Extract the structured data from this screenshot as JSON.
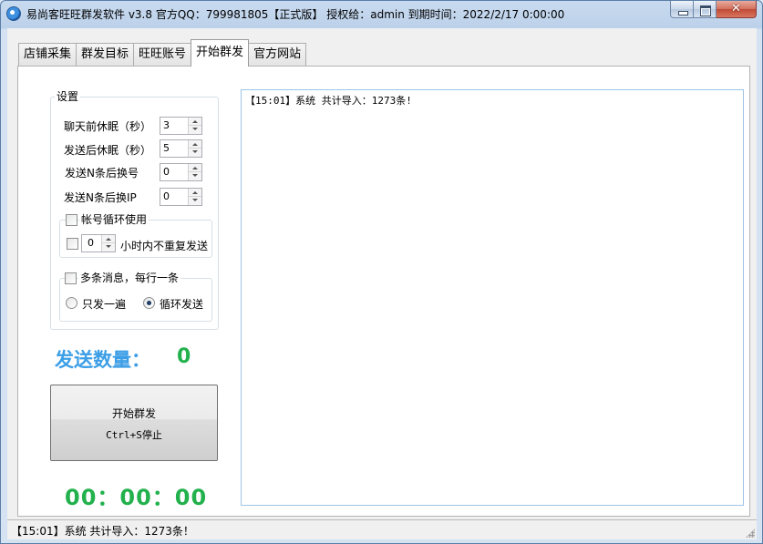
{
  "window": {
    "title": "易尚客旺旺群发软件 v3.8 官方QQ：799981805【正式版】 授权给：admin  到期时间：2022/2/17 0:00:00",
    "close_glyph": "✕"
  },
  "tabs": [
    {
      "label": "店铺采集",
      "active": false
    },
    {
      "label": "群发目标",
      "active": false
    },
    {
      "label": "旺旺账号",
      "active": false
    },
    {
      "label": "开始群发",
      "active": true
    },
    {
      "label": "官方网站",
      "active": false
    }
  ],
  "settings": {
    "group_title": "设置",
    "chat_sleep_label": "聊天前休眠（秒）",
    "chat_sleep_value": "3",
    "send_sleep_label": "发送后休眠（秒）",
    "send_sleep_value": "5",
    "switch_account_label": "发送N条后换号",
    "switch_account_value": "0",
    "switch_ip_label": "发送N条后换IP",
    "switch_ip_value": "0",
    "account_loop_label": "帐号循环使用",
    "account_loop_checked": false,
    "no_repeat_checked": false,
    "no_repeat_hours": "0",
    "no_repeat_label": "小时内不重复发送",
    "multi_msg_label": "多条消息，每行一条",
    "multi_msg_checked": false,
    "send_once_label": "只发一遍",
    "send_once_selected": false,
    "loop_send_label": "循环发送",
    "loop_send_selected": true
  },
  "stats": {
    "count_label": "发送数量：",
    "count_value": "0",
    "timer": "00：00：00"
  },
  "start_button": {
    "line1": "开始群发",
    "line2": "Ctrl+S停止"
  },
  "log": {
    "lines": [
      "【15:01】系统 共计导入：1273条!"
    ]
  },
  "statusbar": {
    "text": "【15:01】系统 共计导入：1273条！"
  },
  "colors": {
    "count_label": "#3c9ee6",
    "green": "#22b14c"
  }
}
